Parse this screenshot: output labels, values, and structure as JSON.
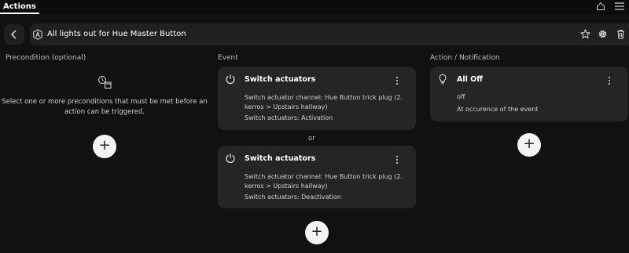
{
  "topbar": {
    "tab_label": "Actions",
    "home_icon": "home-icon",
    "menu_icon": "hamburger-menu-icon"
  },
  "titlebar": {
    "back_icon": "chevron-left-icon",
    "automation_icon": "automation-a-icon",
    "title": "All lights out for Hue Master Button",
    "favorite_icon": "star-icon",
    "settings_icon": "gear-icon",
    "delete_icon": "trash-icon"
  },
  "columns": {
    "precondition_header": "Precondition (optional)",
    "event_header": "Event",
    "action_header": "Action / Notification"
  },
  "precondition": {
    "icon": "clock-calendar-icon",
    "empty_text": "Select one or more preconditions that must be met before an action can be triggered.",
    "add_label": "+"
  },
  "events": [
    {
      "icon": "power-icon",
      "title": "Switch actuators",
      "detail": "Switch actuator channel: Hue Button trick plug (2. kerros > Upstairs hallway)",
      "state": "Switch actuators: Activation"
    },
    {
      "icon": "power-icon",
      "title": "Switch actuators",
      "detail": "Switch actuator channel: Hue Button trick plug (2. kerros > Upstairs hallway)",
      "state": "Switch actuators: Deactivation"
    }
  ],
  "event_separator": "or",
  "event_add_label": "+",
  "actions": [
    {
      "icon": "lightbulb-icon",
      "title": "All Off",
      "value": "off",
      "timing": "At occurence of the event"
    }
  ],
  "action_add_label": "+",
  "colors": {
    "background": "#111111",
    "card": "#252525",
    "text": "#ffffff",
    "muted_text": "#bdbdbd",
    "add_button": "#f3f3f3"
  }
}
